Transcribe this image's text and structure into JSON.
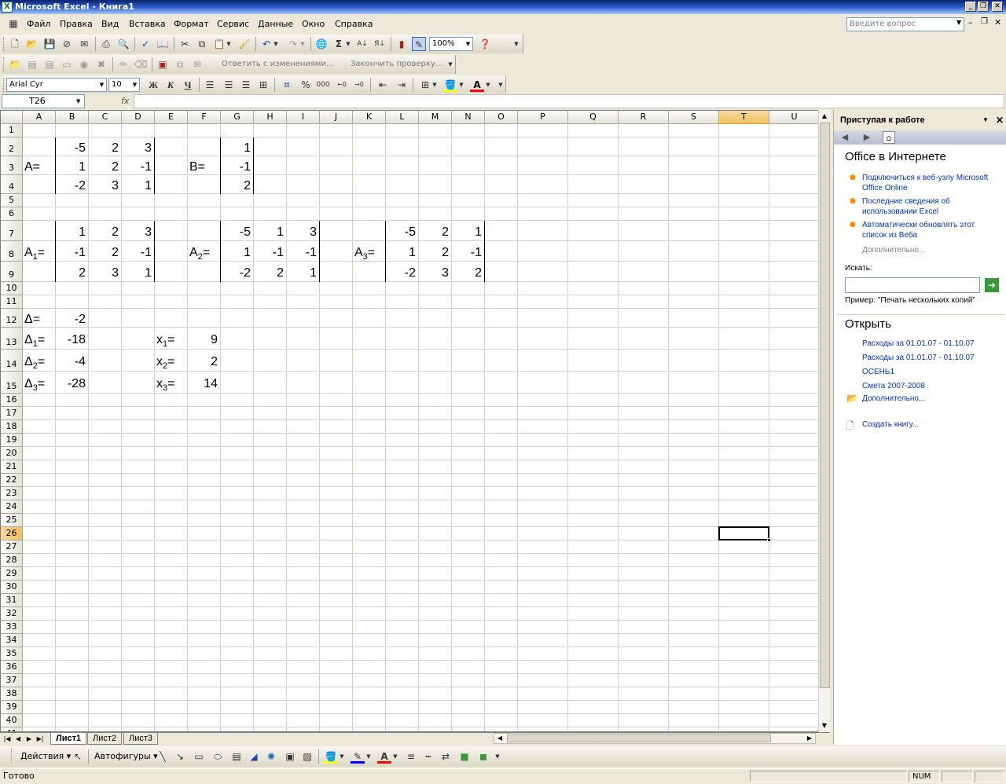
{
  "window": {
    "title": "Microsoft Excel - Книга1"
  },
  "menu": [
    "Файл",
    "Правка",
    "Вид",
    "Вставка",
    "Формат",
    "Сервис",
    "Данные",
    "Окно",
    "Справка"
  ],
  "ask_placeholder": "Введите вопрос",
  "toolbar": {
    "zoom": "100%",
    "font": "Arial Cyr",
    "size": "10",
    "bold": "Ж",
    "italic": "К",
    "underline": "Ч",
    "reply_changes": "Ответить с изменениями...",
    "end_review": "Закончить проверку...",
    "percent": "%",
    "thousands": "000"
  },
  "namebox": "T26",
  "fx": "fx",
  "columns": [
    "A",
    "B",
    "C",
    "D",
    "E",
    "F",
    "G",
    "H",
    "I",
    "J",
    "K",
    "L",
    "M",
    "N",
    "O",
    "P",
    "Q",
    "R",
    "S",
    "T",
    "U"
  ],
  "rows_count": 41,
  "cells": {
    "A3": "A=",
    "F3": "B=",
    "B2": "-5",
    "C2": "2",
    "D2": "3",
    "B3": "1",
    "C3": "2",
    "D3": "-1",
    "B4": "-2",
    "C4": "3",
    "D4": "1",
    "G2": "1",
    "G3": "-1",
    "G4": "2",
    "B7": "1",
    "C7": "2",
    "D7": "3",
    "B8": "-1",
    "C8": "2",
    "D8": "-1",
    "B9": "2",
    "C9": "3",
    "D9": "1",
    "G7": "-5",
    "H7": "1",
    "I7": "3",
    "G8": "1",
    "H8": "-1",
    "I8": "-1",
    "G9": "-2",
    "H9": "2",
    "I9": "1",
    "L7": "-5",
    "M7": "2",
    "N7": "1",
    "L8": "1",
    "M8": "2",
    "N8": "-1",
    "L9": "-2",
    "M9": "3",
    "N9": "2",
    "B12": "-2",
    "B13": "-18",
    "B14": "-4",
    "B15": "-28",
    "F13": "9",
    "F14": "2",
    "F15": "14"
  },
  "labels": {
    "a1": {
      "base": "A",
      "sub": "1",
      "tail": "="
    },
    "a2": {
      "base": "A",
      "sub": "2",
      "tail": "="
    },
    "a3": {
      "base": "A",
      "sub": "3",
      "tail": "="
    },
    "d": {
      "base": "Δ=",
      "sub": "",
      "tail": ""
    },
    "d1": {
      "base": "Δ",
      "sub": "1",
      "tail": "="
    },
    "d2": {
      "base": "Δ",
      "sub": "2",
      "tail": "="
    },
    "d3": {
      "base": "Δ",
      "sub": "3",
      "tail": "="
    },
    "x1": {
      "base": "x",
      "sub": "1",
      "tail": "="
    },
    "x2": {
      "base": "x",
      "sub": "2",
      "tail": "="
    },
    "x3": {
      "base": "x",
      "sub": "3",
      "tail": "="
    }
  },
  "sheets": [
    "Лист1",
    "Лист2",
    "Лист3"
  ],
  "taskpane": {
    "title": "Приступая к работе",
    "online_heading": "Office в Интернете",
    "online_links": [
      "Подключиться к веб-узлу Microsoft Office Online",
      "Последние сведения об использовании Excel",
      "Автоматически обновлять этот список из Веба"
    ],
    "more": "Дополнительно...",
    "search_label": "Искать:",
    "example": "Пример:  \"Печать нескольких копий\"",
    "open_heading": "Открыть",
    "files": [
      "Расходы за 01.01.07 - 01.10.07",
      "Расходы за 01.01.07 - 01.10.07",
      "ОСЕНЬ1",
      "Смета 2007-2008"
    ],
    "open_more": "Дополнительно...",
    "create": "Создать книгу..."
  },
  "drawing": {
    "actions": "Действия",
    "autoshapes": "Автофигуры"
  },
  "status": {
    "ready": "Готово",
    "num": "NUM"
  }
}
